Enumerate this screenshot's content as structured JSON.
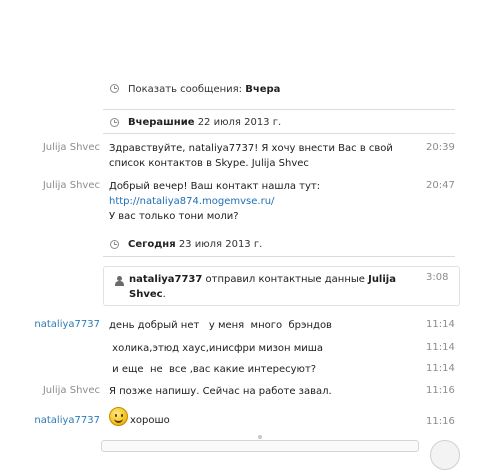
{
  "show_messages": {
    "label": "Показать сообщения:",
    "value": "Вчера"
  },
  "day_yesterday": {
    "label": "Вчерашние",
    "date": "22 июля 2013 г."
  },
  "day_today": {
    "label": "Сегодня",
    "date": "23 июля 2013 г."
  },
  "messages": [
    {
      "sender": "Julija Shvec",
      "lines": [
        "Здравствуйте, nataliya7737! Я хочу внести Вас в свой",
        "список контактов в Skype. Julija Shvec"
      ],
      "time": "20:39"
    },
    {
      "sender": "Julija Shvec",
      "line1": "Добрый вечер! Ваш контакт нашла тут:",
      "link": "http://nataliya874.mogemvse.ru/",
      "line3": "У вас только тони моли?",
      "time": "20:47"
    },
    {
      "sender": "nataliya7737",
      "text": "день добрый нет   у меня  много  брэндов",
      "time": "11:14"
    },
    {
      "sender": "",
      "text": " холика,этюд хаус,инисфри мизон миша",
      "time": "11:14"
    },
    {
      "sender": "",
      "text": " и еще  не  все ,вас какие интересуют?",
      "time": "11:14"
    },
    {
      "sender": "Julija Shvec",
      "text": "Я позже напишу. Сейчас на работе завал.",
      "time": "11:16"
    },
    {
      "sender": "nataliya7737",
      "text": "хорошо",
      "time": "11:16"
    }
  ],
  "contact_share": {
    "from": "nataliya7737",
    "action": " отправил контактные данные ",
    "contact_first": "Julija",
    "contact_second": "Shvec",
    "period": ".",
    "time": "3:08"
  },
  "icons": {
    "clock": "clock-icon",
    "contact": "person-icon",
    "emoticon": "smiley-icon"
  }
}
